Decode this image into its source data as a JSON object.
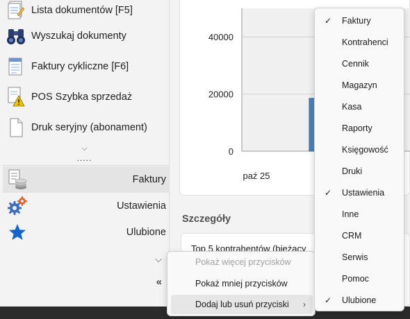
{
  "sidebar": {
    "items": [
      {
        "label": "Lista dokumentów [F5]",
        "icon": "document-list-icon"
      },
      {
        "label": "Wyszukaj dokumenty",
        "icon": "binoculars-icon"
      },
      {
        "label": "Faktury cykliczne [F6]",
        "icon": "recurring-invoice-icon"
      },
      {
        "label": "POS Szybka sprzedaż",
        "icon": "warning-document-icon"
      },
      {
        "label": "Druk seryjny (abonament)",
        "icon": "blank-document-icon"
      }
    ],
    "expand_glyph": "⌵",
    "grip_glyph": ".....",
    "modules": [
      {
        "label": "Faktury",
        "icon": "invoice-coins-icon",
        "active": true
      },
      {
        "label": "Ustawienia",
        "icon": "gears-icon",
        "active": false
      },
      {
        "label": "Ulubione",
        "icon": "star-icon",
        "active": false
      }
    ],
    "more_glyph": "⌵",
    "collapse_glyph": "«"
  },
  "chart_data": {
    "type": "bar",
    "categories": [
      "paź 25"
    ],
    "yticks": [
      "40000",
      "20000",
      "0"
    ],
    "ylim": [
      0,
      50000
    ],
    "series": [
      {
        "values": [
          18500
        ]
      }
    ],
    "colors": {
      "bar": "#4f81bd",
      "grid": "#d0d0d0",
      "plot_bg": "#f0f0f0"
    }
  },
  "details": {
    "title": "Szczegóły",
    "first_line": "Top 5 kontrahentów (bieżący"
  },
  "context_menu": {
    "items": [
      {
        "label": "Pokaż więcej przycisków",
        "disabled": true
      },
      {
        "label": "Pokaż mniej przycisków",
        "disabled": false
      },
      {
        "label": "Dodaj lub usuń przyciski",
        "disabled": false,
        "submenu_arrow": "›"
      }
    ]
  },
  "submenu": {
    "check_glyph": "✓",
    "items": [
      {
        "label": "Faktury",
        "checked": true
      },
      {
        "label": "Kontrahenci",
        "checked": false
      },
      {
        "label": "Cennik",
        "checked": false
      },
      {
        "label": "Magazyn",
        "checked": false
      },
      {
        "label": "Kasa",
        "checked": false
      },
      {
        "label": "Raporty",
        "checked": false
      },
      {
        "label": "Księgowość",
        "checked": false
      },
      {
        "label": "Druki",
        "checked": false
      },
      {
        "label": "Ustawienia",
        "checked": true
      },
      {
        "label": "Inne",
        "checked": false
      },
      {
        "label": "CRM",
        "checked": false
      },
      {
        "label": "Serwis",
        "checked": false
      },
      {
        "label": "Pomoc",
        "checked": false
      },
      {
        "label": "Ulubione",
        "checked": true
      }
    ]
  }
}
